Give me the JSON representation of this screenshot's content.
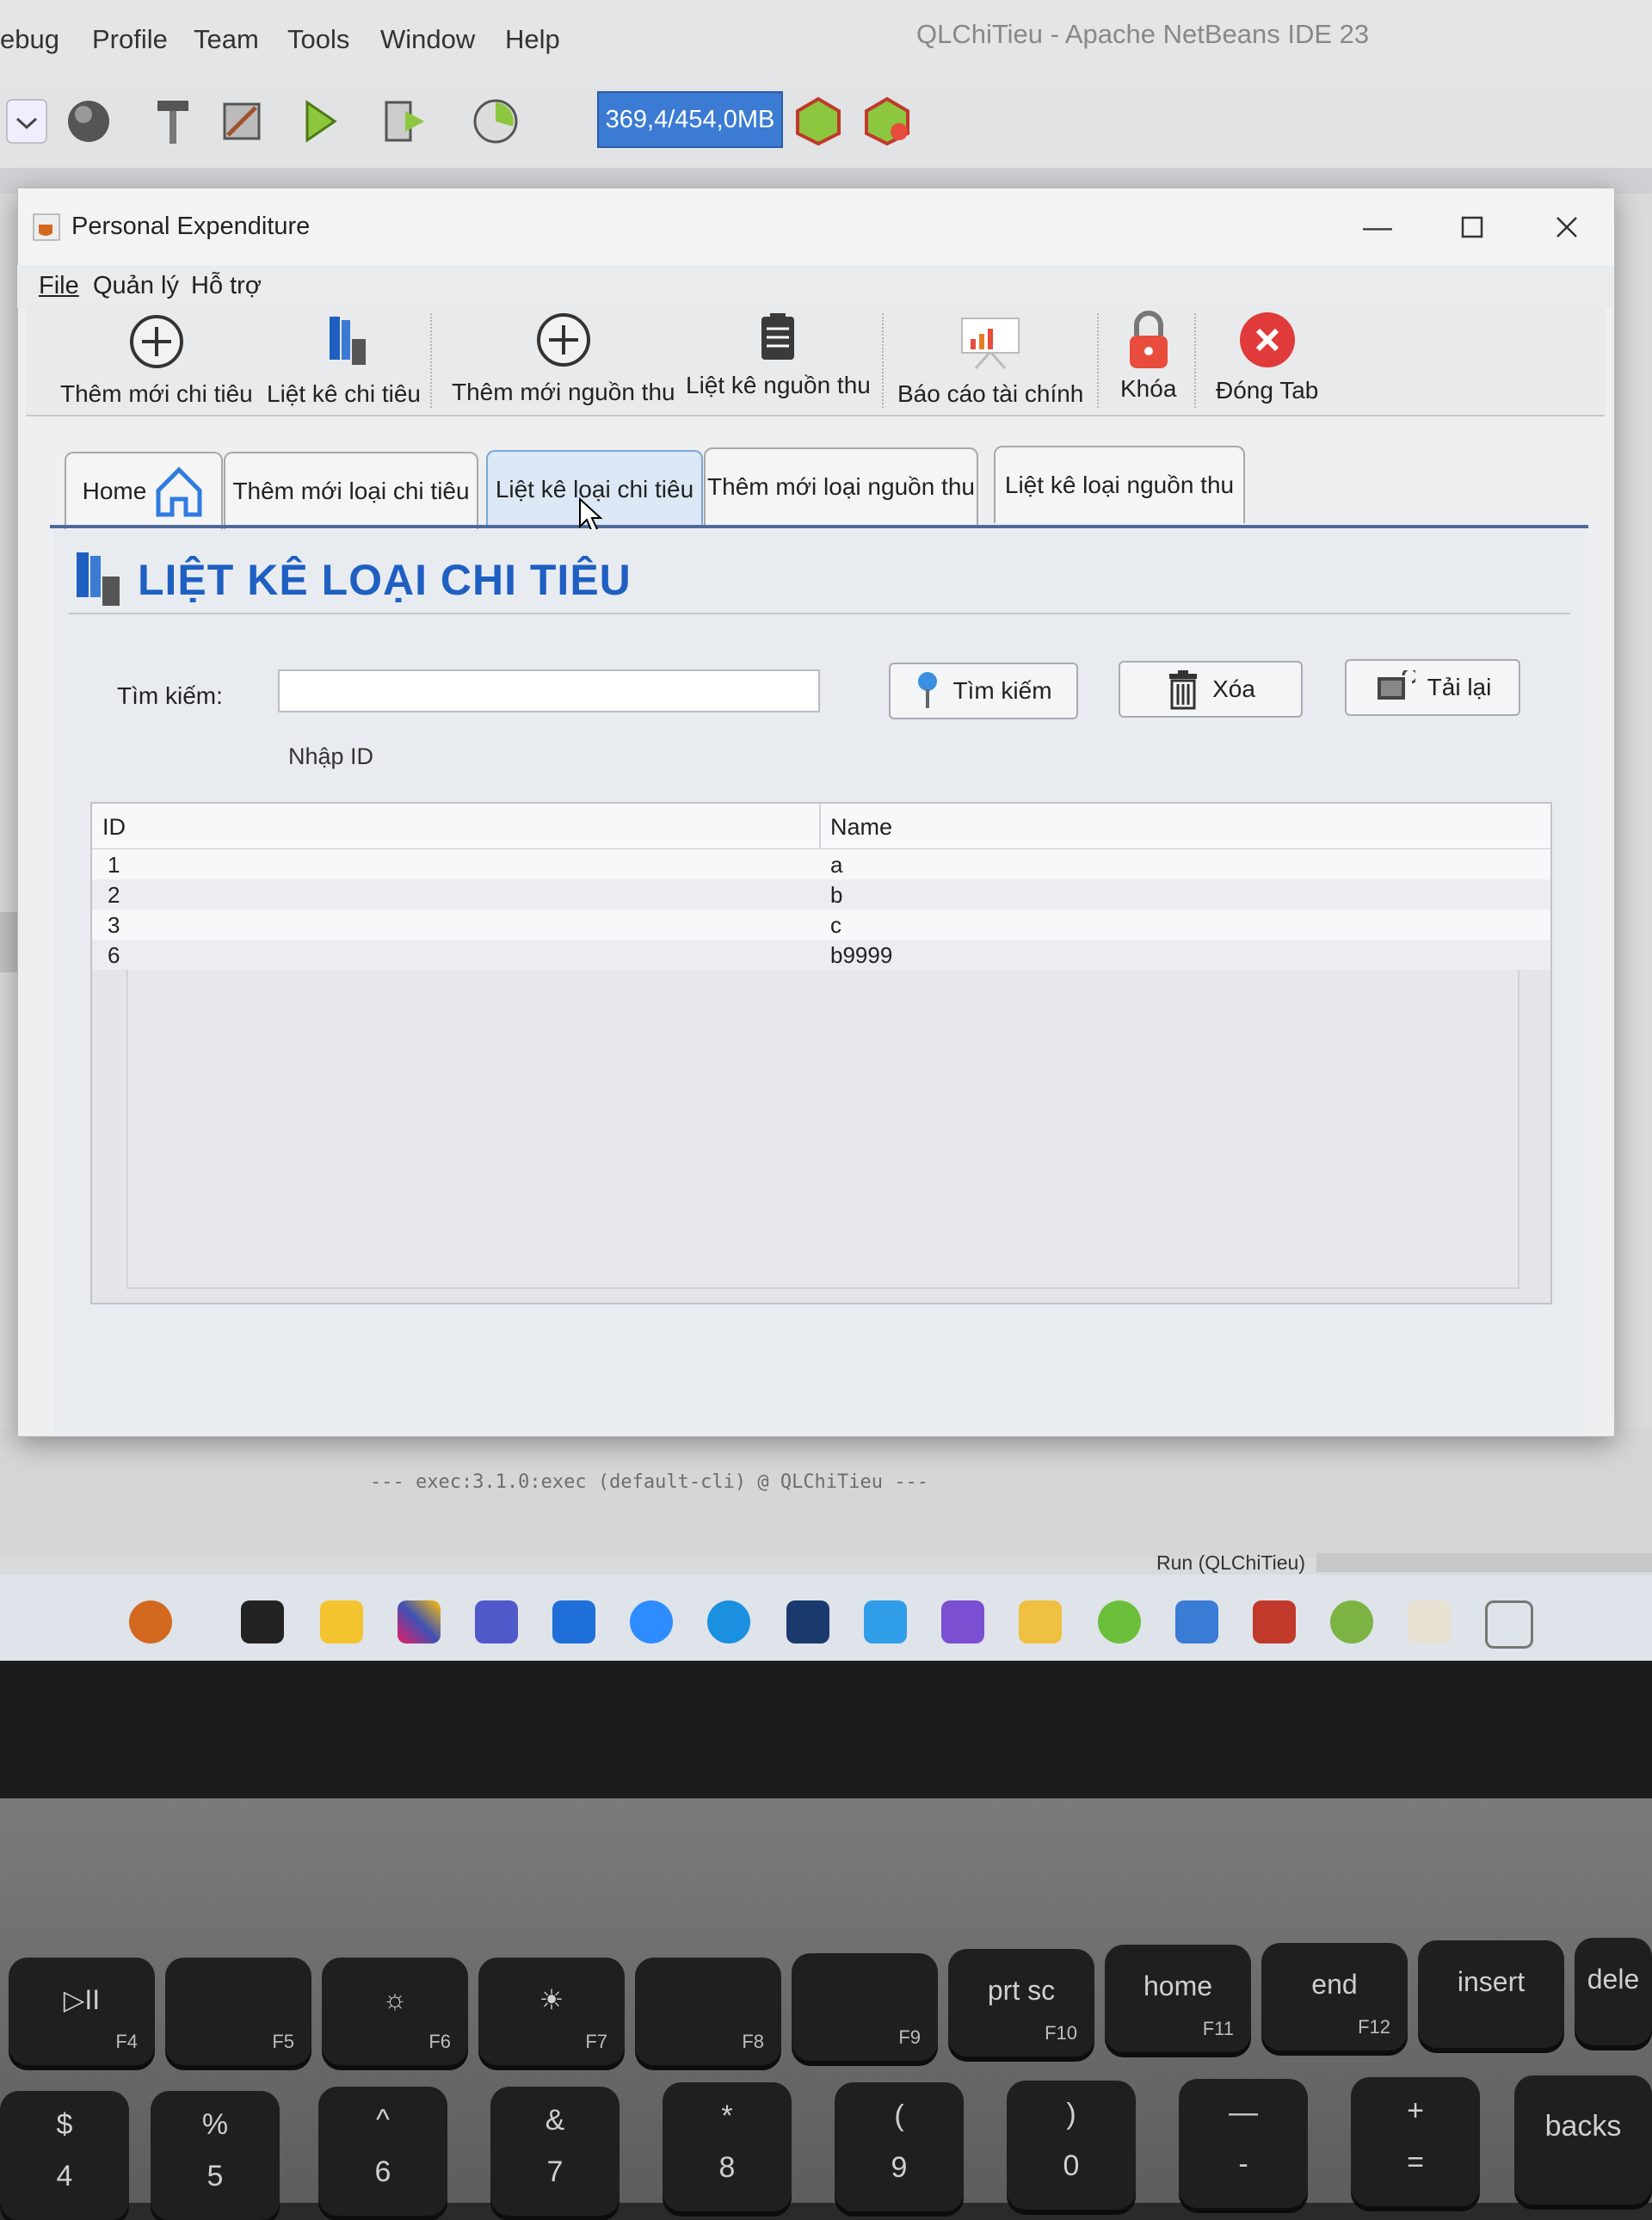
{
  "ide": {
    "menu": [
      "ebug",
      "Profile",
      "Team",
      "Tools",
      "Window",
      "Help"
    ],
    "title": "QLChiTieu - Apache NetBeans IDE 23",
    "memory": "369,4/454,0MB",
    "console_line": "--- exec:3.1.0:exec (default-cli) @ QLChiTieu ---",
    "run_status": "Run (QLChiTieu)"
  },
  "window": {
    "title": "Personal Expenditure",
    "menu": [
      "File",
      "Quản lý",
      "Hỗ trợ"
    ],
    "toolbar": [
      {
        "label": "Thêm mới chi tiêu",
        "icon": "plus-circle-icon"
      },
      {
        "label": "Liệt kê chi tiêu",
        "icon": "books-icon"
      },
      {
        "label": "Thêm mới nguồn thu",
        "icon": "plus-circle-icon"
      },
      {
        "label": "Liệt kê nguồn thu",
        "icon": "clipboard-list-icon"
      },
      {
        "label": "Báo cáo tài chính",
        "icon": "chart-board-icon"
      },
      {
        "label": "Khóa",
        "icon": "padlock-icon"
      },
      {
        "label": "Đóng Tab",
        "icon": "close-circle-icon"
      }
    ],
    "tabs": [
      "Home",
      "Thêm mới loại chi tiêu",
      "Liệt kê loại chi tiêu",
      "Thêm mới loại nguồn thu",
      "Liệt kê loại nguồn thu"
    ],
    "active_tab": "Liệt kê loại chi tiêu",
    "page_title": "LIỆT KÊ LOẠI CHI TIÊU",
    "search": {
      "label": "Tìm kiếm:",
      "value": "",
      "hint": "Nhập ID"
    },
    "buttons": {
      "search": "Tìm kiếm",
      "delete": "Xóa",
      "reload": "Tải lại"
    },
    "table": {
      "columns": [
        "ID",
        "Name"
      ],
      "rows": [
        {
          "id": "1",
          "name": "a"
        },
        {
          "id": "2",
          "name": "b"
        },
        {
          "id": "3",
          "name": "c"
        },
        {
          "id": "6",
          "name": "b9999"
        }
      ]
    }
  },
  "keyboard": {
    "fn_row": [
      {
        "main": "▷II",
        "fn": "F4"
      },
      {
        "main": "",
        "fn": "F5"
      },
      {
        "main": "☼",
        "fn": "F6"
      },
      {
        "main": "☀",
        "fn": "F7"
      },
      {
        "main": "",
        "fn": "F8"
      },
      {
        "main": "",
        "fn": "F9"
      },
      {
        "main": "prt sc",
        "fn": "F10"
      },
      {
        "main": "home",
        "fn": "F11"
      },
      {
        "main": "end",
        "fn": "F12"
      },
      {
        "main": "insert",
        "fn": ""
      },
      {
        "main": "dele",
        "fn": ""
      }
    ],
    "num_row": [
      {
        "top": "$",
        "bot": "4"
      },
      {
        "top": "%",
        "bot": "5"
      },
      {
        "top": "^",
        "bot": "6"
      },
      {
        "top": "&",
        "bot": "7"
      },
      {
        "top": "*",
        "bot": "8"
      },
      {
        "top": "(",
        "bot": "9"
      },
      {
        "top": ")",
        "bot": "0"
      },
      {
        "top": "—",
        "bot": "-"
      },
      {
        "top": "+",
        "bot": "="
      },
      {
        "top": "backs",
        "bot": ""
      }
    ]
  },
  "colors": {
    "accent": "#1f5fc2",
    "memory_bar": "#3b7bd4",
    "close_red": "#e03a3a"
  }
}
